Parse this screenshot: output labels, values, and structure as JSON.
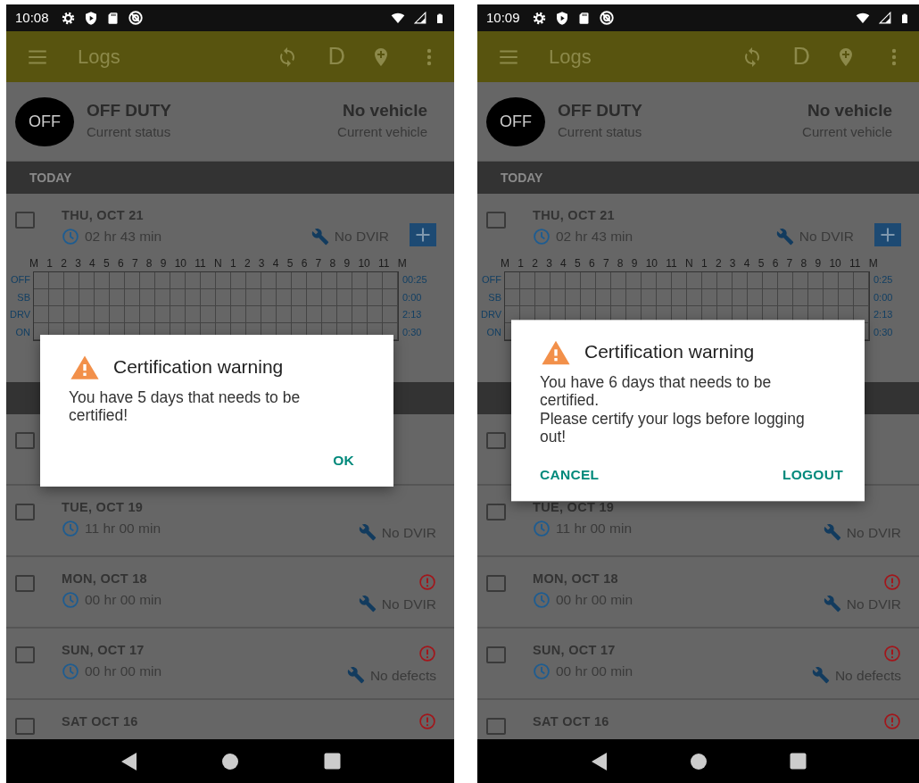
{
  "screens": [
    {
      "status_bar": {
        "time": "10:08"
      },
      "app_bar": {
        "title": "Logs",
        "action_letter": "D"
      },
      "current": {
        "badge": "OFF",
        "status": "OFF DUTY",
        "status_label": "Current status",
        "vehicle": "No vehicle",
        "vehicle_label": "Current vehicle"
      },
      "today": {
        "header": "TODAY",
        "date": "THU, OCT 21",
        "hours": "02 hr  43 min",
        "dvir": "No DVIR",
        "checked": false,
        "timeline": {
          "hour_labels": [
            "M",
            "1",
            "2",
            "3",
            "4",
            "5",
            "6",
            "7",
            "8",
            "9",
            "10",
            "11",
            "N",
            "1",
            "2",
            "3",
            "4",
            "5",
            "6",
            "7",
            "8",
            "9",
            "10",
            "11",
            "M"
          ],
          "rows": [
            {
              "label": "OFF",
              "total": "00:25"
            },
            {
              "label": "SB",
              "total": "0:00"
            },
            {
              "label": "DRV",
              "total": "2:13"
            },
            {
              "label": "ON",
              "total": "0:30"
            }
          ]
        }
      },
      "covered_log": {
        "checked": false
      },
      "past_logs": [
        {
          "date": "TUE, OCT 19",
          "hours": "11 hr  00 min",
          "dvir": "No DVIR",
          "alert": false,
          "checked": false
        },
        {
          "date": "MON, OCT 18",
          "hours": "00 hr  00 min",
          "dvir": "No DVIR",
          "alert": true,
          "checked": false
        },
        {
          "date": "SUN, OCT 17",
          "hours": "00 hr  00 min",
          "dvir": "No defects",
          "alert": true,
          "checked": false
        },
        {
          "date": "SAT OCT 16",
          "alert": true,
          "checked": false
        }
      ],
      "dialog": {
        "title": "Certification warning",
        "message": [
          "You have 5 days that needs to be certified!"
        ],
        "buttons": [
          "OK"
        ]
      }
    },
    {
      "status_bar": {
        "time": "10:09"
      },
      "app_bar": {
        "title": "Logs",
        "action_letter": "D"
      },
      "current": {
        "badge": "OFF",
        "status": "OFF DUTY",
        "status_label": "Current status",
        "vehicle": "No vehicle",
        "vehicle_label": "Current vehicle"
      },
      "today": {
        "header": "TODAY",
        "date": "THU, OCT 21",
        "hours": "02 hr  43 min",
        "dvir": "No DVIR",
        "checked": false,
        "timeline": {
          "hour_labels": [
            "M",
            "1",
            "2",
            "3",
            "4",
            "5",
            "6",
            "7",
            "8",
            "9",
            "10",
            "11",
            "N",
            "1",
            "2",
            "3",
            "4",
            "5",
            "6",
            "7",
            "8",
            "9",
            "10",
            "11",
            "M"
          ],
          "rows": [
            {
              "label": "OFF",
              "total": "0:25"
            },
            {
              "label": "SB",
              "total": "0:00"
            },
            {
              "label": "DRV",
              "total": "2:13"
            },
            {
              "label": "ON",
              "total": "0:30"
            }
          ]
        }
      },
      "covered_log": {
        "checked": false
      },
      "past_logs": [
        {
          "date": "TUE, OCT 19",
          "hours": "11 hr  00 min",
          "dvir": "No DVIR",
          "alert": false,
          "checked": false
        },
        {
          "date": "MON, OCT 18",
          "hours": "00 hr  00 min",
          "dvir": "No DVIR",
          "alert": true,
          "checked": false
        },
        {
          "date": "SUN, OCT 17",
          "hours": "00 hr  00 min",
          "dvir": "No defects",
          "alert": true,
          "checked": false
        },
        {
          "date": "SAT OCT 16",
          "alert": true,
          "checked": false
        }
      ],
      "dialog": {
        "title": "Certification warning",
        "message": [
          "You have 6 days that needs to be certified.",
          "Please certify your logs before logging out!"
        ],
        "buttons": [
          "CANCEL",
          "LOGOUT"
        ]
      }
    }
  ]
}
